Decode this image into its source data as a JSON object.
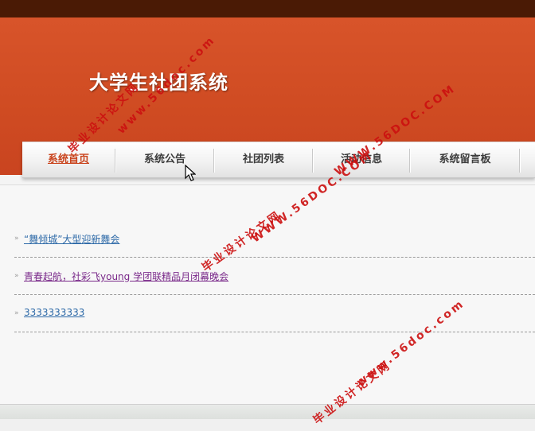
{
  "header": {
    "title": "大学生社团系统"
  },
  "nav": {
    "items": [
      {
        "label": "系统首页"
      },
      {
        "label": "系统公告"
      },
      {
        "label": "社团列表"
      },
      {
        "label": "活动信息"
      },
      {
        "label": "系统留言板"
      }
    ]
  },
  "announcements": [
    {
      "title": "“舞倾城”大型迎新舞会",
      "color": "#2e6aa8"
    },
    {
      "title": "青春起航，社彩飞young 学团联精品月闭幕晚会",
      "color": "#7a2a8a"
    },
    {
      "title": "3333333333",
      "color": "#2e6aa8"
    }
  ],
  "watermarks": {
    "cn": "毕业设计论文网",
    "url": "www.56doc.com",
    "url_upper": "WWW.56DOC.COM"
  },
  "colors": {
    "brand": "#d24e25",
    "topbar": "#4a1a05",
    "nav_active": "#c9431c"
  }
}
